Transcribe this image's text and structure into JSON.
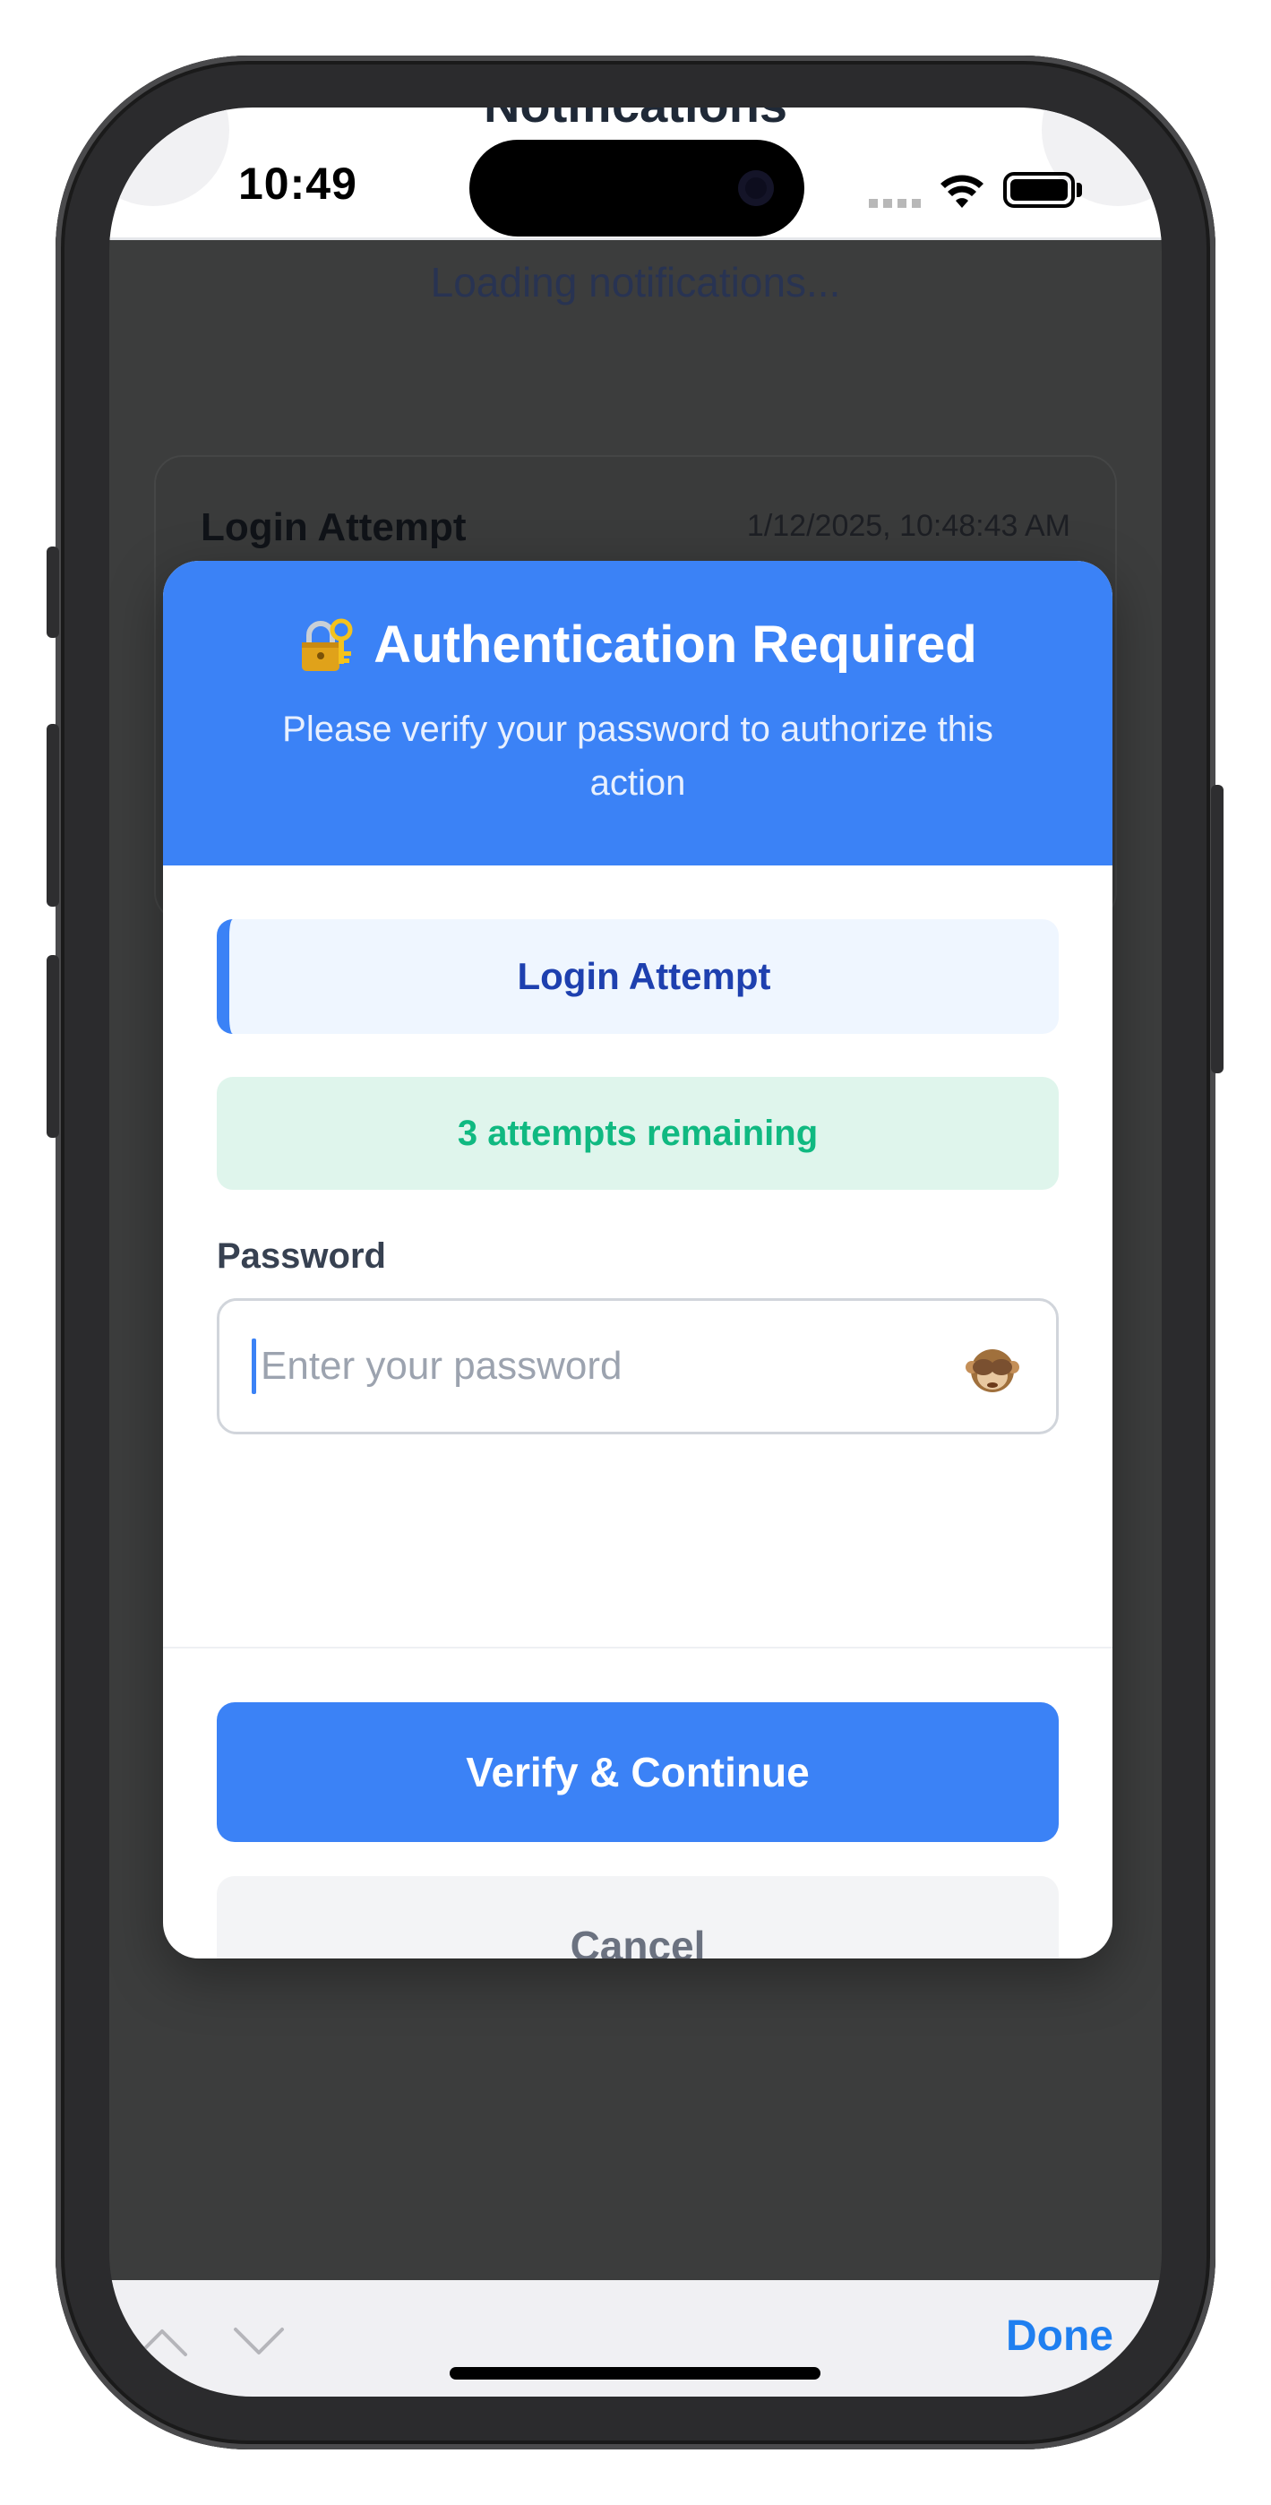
{
  "status_bar": {
    "time": "10:49"
  },
  "app_header": {
    "title": "Notifications"
  },
  "background": {
    "loading_text": "Loading notifications...",
    "card_title": "Login Attempt",
    "card_timestamp": "1/12/2025, 10:48:43 AM"
  },
  "modal": {
    "title": "Authentication Required",
    "subtitle": "Please verify your password to authorize this action",
    "context_label": "Login Attempt",
    "attempts_text": "3 attempts remaining",
    "password_label": "Password",
    "password_placeholder": "Enter your password",
    "password_value": "",
    "verify_label": "Verify & Continue",
    "cancel_label": "Cancel"
  },
  "keyboard_bar": {
    "done_label": "Done"
  },
  "icons": {
    "title_icon": "lock-with-key-icon",
    "visibility_toggle": "see-no-evil-monkey-icon",
    "prev": "chevron-up-icon",
    "next": "chevron-down-icon"
  },
  "colors": {
    "primary": "#3b82f6",
    "success": "#10b981",
    "context_text": "#1e40af",
    "overlay": "#3c3d3d",
    "done_blue": "#1f7ff0"
  }
}
